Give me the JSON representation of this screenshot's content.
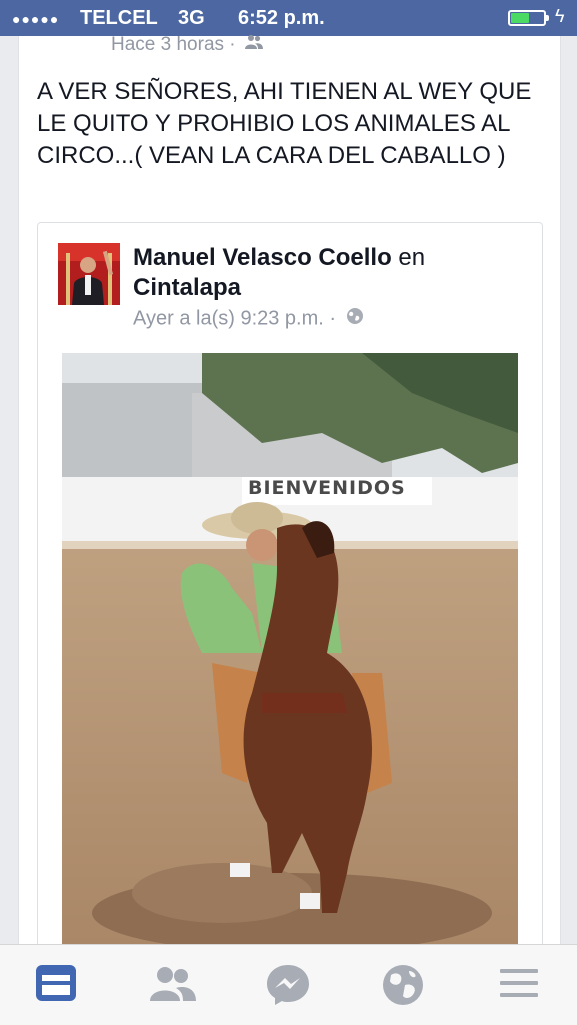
{
  "status_bar": {
    "signal": "●●●●●",
    "carrier": "TELCEL",
    "network": "3G",
    "time": "6:52 p.m.",
    "battery_level": 0.45,
    "icons": [
      "signal-dots-icon",
      "battery-icon",
      "charging-bolt-icon"
    ]
  },
  "post": {
    "time": "Hace 3 horas",
    "separator": "·",
    "audience_icon": "friends-icon",
    "text": "A VER SEÑORES, AHI TIENEN AL WEY QUE LE QUITO Y PROHIBIO LOS ANIMALES AL CIRCO...( VEAN LA CARA DEL CABALLO )"
  },
  "shared_post": {
    "author": "Manuel Velasco Coello",
    "connector": "en",
    "place": "Cintalapa",
    "time": "Ayer a la(s) 9:23 p.m.",
    "separator": "·",
    "audience_icon": "globe-icon",
    "photo_caption": "BIENVENIDOS"
  },
  "tab_bar": {
    "tabs": [
      {
        "icon": "news-feed-icon",
        "active": true
      },
      {
        "icon": "friend-requests-icon",
        "active": false
      },
      {
        "icon": "messenger-icon",
        "active": false
      },
      {
        "icon": "notifications-globe-icon",
        "active": false
      },
      {
        "icon": "menu-icon",
        "active": false
      }
    ],
    "active_color": "#4267b2",
    "inactive_color": "#a7acb5"
  },
  "colors": {
    "brand": "#4c67a1",
    "text": "#141823",
    "muted": "#9197a3"
  }
}
